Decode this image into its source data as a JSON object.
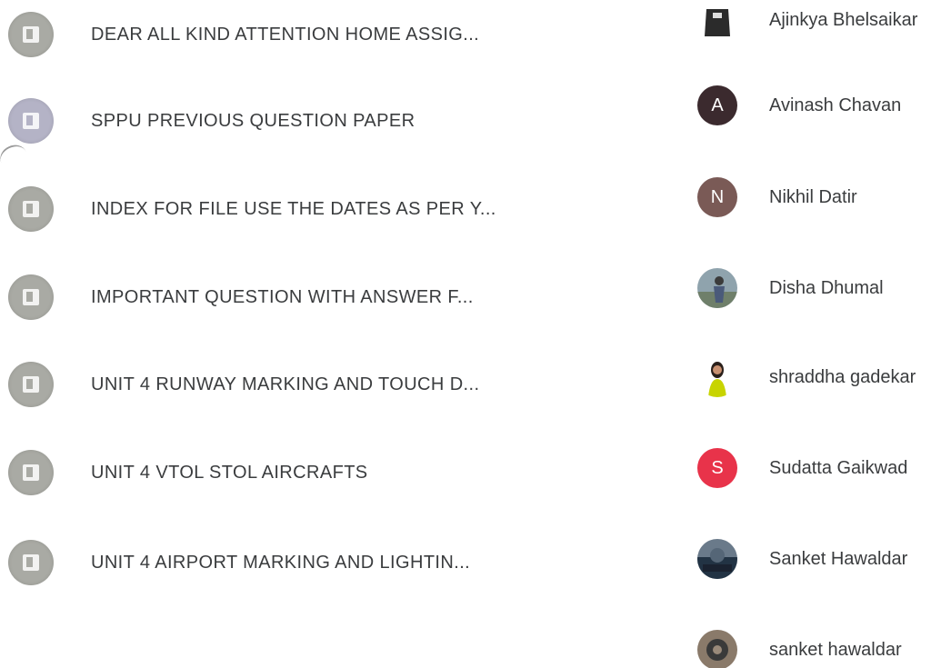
{
  "materials": [
    {
      "title": "DEAR ALL KIND ATTENTION HOME ASSIG...",
      "icon": "material-icon"
    },
    {
      "title": "SPPU PREVIOUS QUESTION PAPER",
      "icon": "material-icon"
    },
    {
      "title": "INDEX FOR FILE USE THE DATES AS PER Y...",
      "icon": "material-icon"
    },
    {
      "title": "IMPORTANT QUESTION WITH ANSWER F...",
      "icon": "material-icon"
    },
    {
      "title": "UNIT 4 RUNWAY MARKING AND TOUCH D...",
      "icon": "material-icon"
    },
    {
      "title": "UNIT 4 VTOL STOL AIRCRAFTS",
      "icon": "material-icon"
    },
    {
      "title": "UNIT 4 AIRPORT MARKING AND LIGHTIN...",
      "icon": "material-icon"
    }
  ],
  "people": [
    {
      "name": "Ajinkya Bhelsaikar",
      "avatar": "photo",
      "avatar_color": "#2b2b2b"
    },
    {
      "name": "Avinash Chavan",
      "avatar_letter": "A",
      "avatar_color": "#3b2a2e"
    },
    {
      "name": "Nikhil Datir",
      "avatar_letter": "N",
      "avatar_color": "#7a5a56"
    },
    {
      "name": "Disha Dhumal",
      "avatar": "photo",
      "avatar_color": "#6a8a9a"
    },
    {
      "name": "shraddha gadekar",
      "avatar": "photo",
      "avatar_color": "#c8d400"
    },
    {
      "name": "Sudatta Gaikwad",
      "avatar_letter": "S",
      "avatar_color": "#e8334a"
    },
    {
      "name": "Sanket Hawaldar",
      "avatar": "photo",
      "avatar_color": "#223344"
    },
    {
      "name": "sanket hawaldar",
      "avatar": "photo",
      "avatar_color": "#3a3a3a"
    }
  ]
}
